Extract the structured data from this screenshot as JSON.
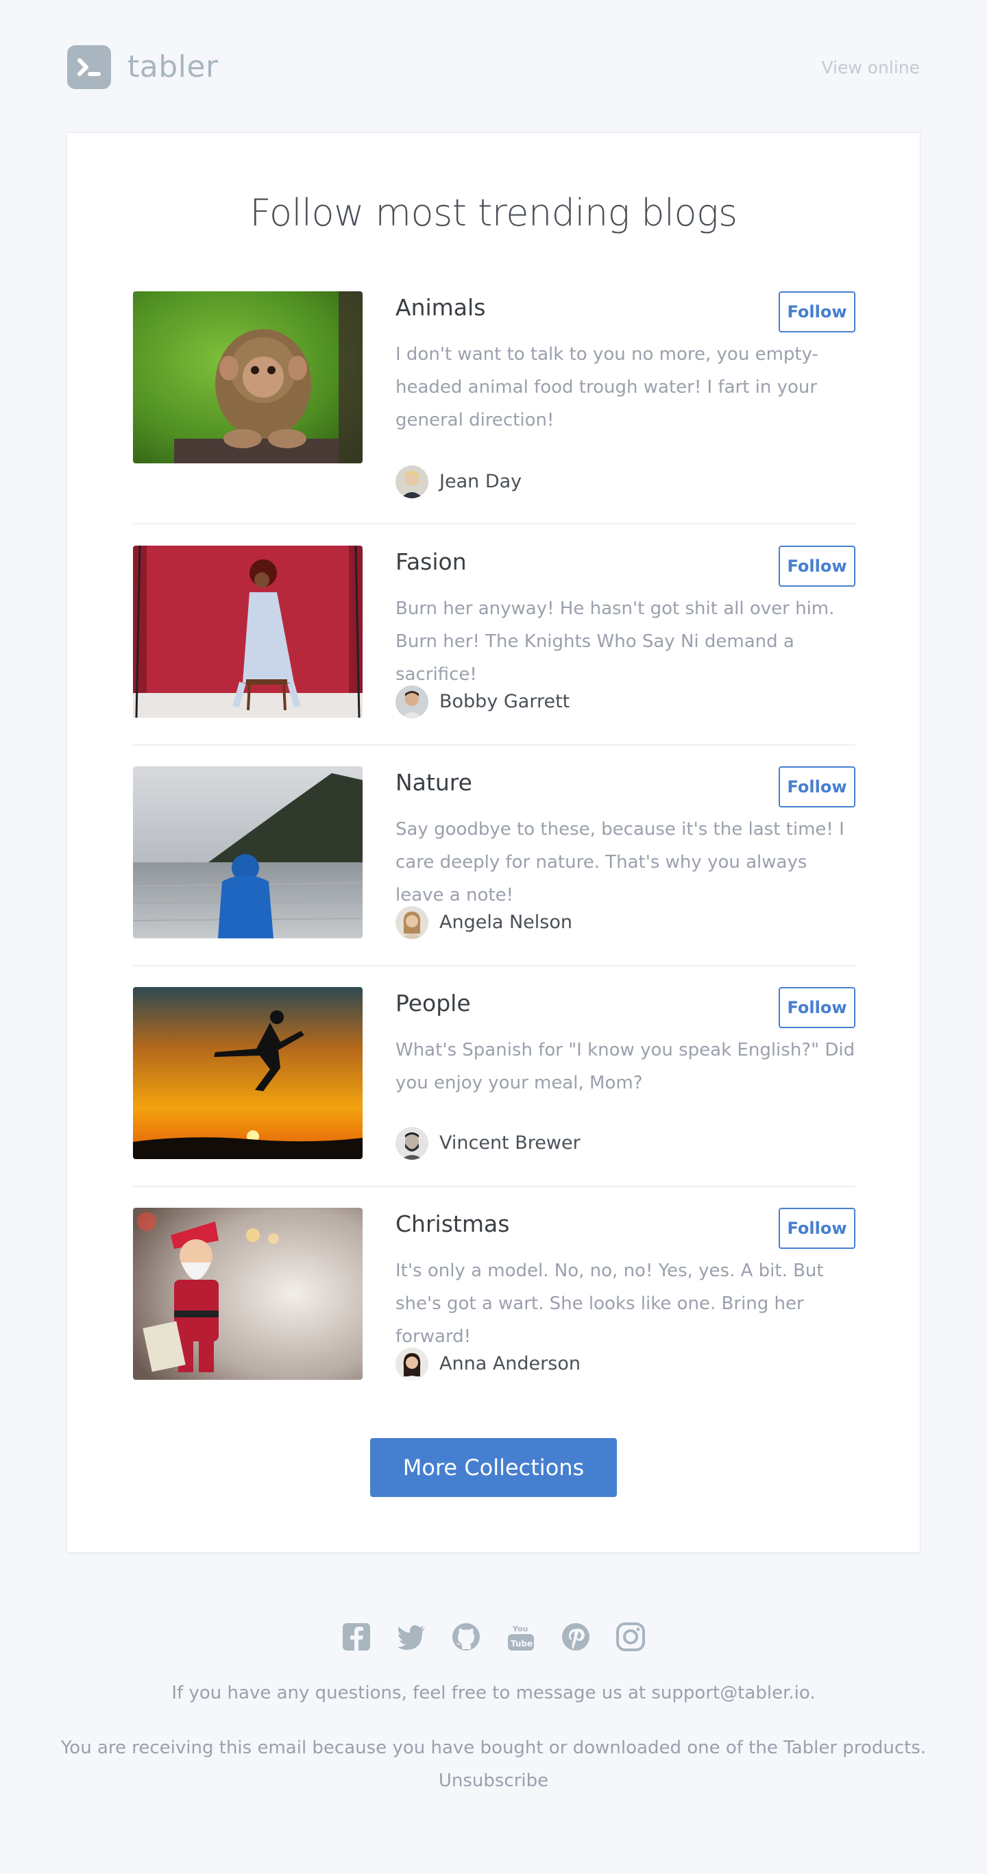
{
  "header": {
    "brand": "tabler",
    "view_online": "View online"
  },
  "card": {
    "title": "Follow most trending blogs",
    "blogs": [
      {
        "title": "Animals",
        "follow": "Follow",
        "description": "I don't want to talk to you no more, you empty-headed animal food trough water! I fart in your general direction!",
        "author": "Jean Day",
        "image": "monkey-photo"
      },
      {
        "title": "Fasion",
        "follow": "Follow",
        "description": "Burn her anyway! He hasn't got shit all over him. Burn her! The Knights Who Say Ni demand a sacrifice!",
        "author": "Bobby Garrett",
        "image": "fashion-photo"
      },
      {
        "title": "Nature",
        "follow": "Follow",
        "description": "Say goodbye to these, because it's the last time! I care deeply for nature. That's why you always leave a note!",
        "author": "Angela Nelson",
        "image": "lake-photo"
      },
      {
        "title": "People",
        "follow": "Follow",
        "description": "What's Spanish for \"I know you speak English?\" Did you enjoy your meal, Mom?",
        "author": "Vincent Brewer",
        "image": "sunset-kick-photo"
      },
      {
        "title": "Christmas",
        "follow": "Follow",
        "description": "It's only a model. No, no, no! Yes, yes. A bit. But she's got a wart. She looks like one. Bring her forward!",
        "author": "Anna Anderson",
        "image": "santa-figurine-photo"
      }
    ],
    "more_button": "More Collections"
  },
  "footer": {
    "socials": [
      "facebook-icon",
      "twitter-icon",
      "github-icon",
      "youtube-icon",
      "pinterest-icon",
      "instagram-icon"
    ],
    "questions_prefix": "If you have any questions, feel free to message us at ",
    "support_email": "support@tabler.io",
    "questions_suffix": ".",
    "receiving": "You are receiving this email because you have bought or downloaded one of the Tabler products.",
    "unsubscribe": "Unsubscribe"
  },
  "colors": {
    "background": "#f5f7fb",
    "primary": "#467fcf",
    "muted": "#9aa0ac",
    "logo": "#a9b5bf"
  }
}
